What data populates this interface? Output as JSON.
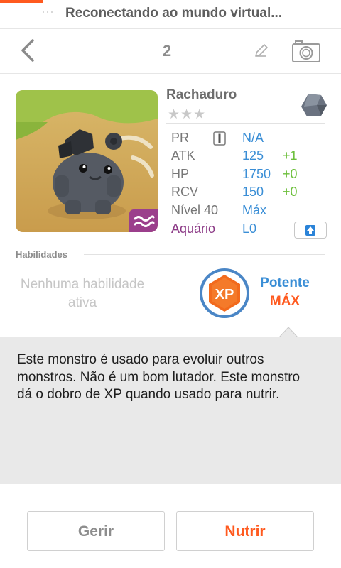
{
  "status": {
    "title": "Reconectando ao mundo virtual...",
    "accent_color": "#ff5a1f"
  },
  "nav": {
    "back_icon": "chevron-left-icon",
    "number": "2",
    "edit_icon": "pencil-icon",
    "camera_icon": "camera-icon"
  },
  "monster": {
    "name": "Rachaduro",
    "stars": "★★★",
    "type_icon": "rock-type-icon",
    "element_icon": "water-wave-icon",
    "element_color": "#9b3f8c",
    "stats": [
      {
        "label": "PR",
        "value": "N/A",
        "bonus": ""
      },
      {
        "label": "ATK",
        "value": "125",
        "bonus": "+1"
      },
      {
        "label": "HP",
        "value": "1750",
        "bonus": "+0"
      },
      {
        "label": "RCV",
        "value": "150",
        "bonus": "+0"
      },
      {
        "label": "Nível 40",
        "value": "Máx",
        "bonus": ""
      },
      {
        "label": "Aquário",
        "value": "L0",
        "bonus": ""
      }
    ]
  },
  "abilities": {
    "title": "Habilidades",
    "none_text_1": "Nenhuma habilidade",
    "none_text_2": "ativa",
    "xp_label": "XP",
    "potency_label": "Potente",
    "potency_value": "MÁX"
  },
  "description": "Este monstro é usado para evoluir outros monstros. Não é um bom lutador. Este monstro dá o dobro de XP quando usado para nutrir.",
  "buttons": {
    "manage": "Gerir",
    "feed": "Nutrir"
  }
}
